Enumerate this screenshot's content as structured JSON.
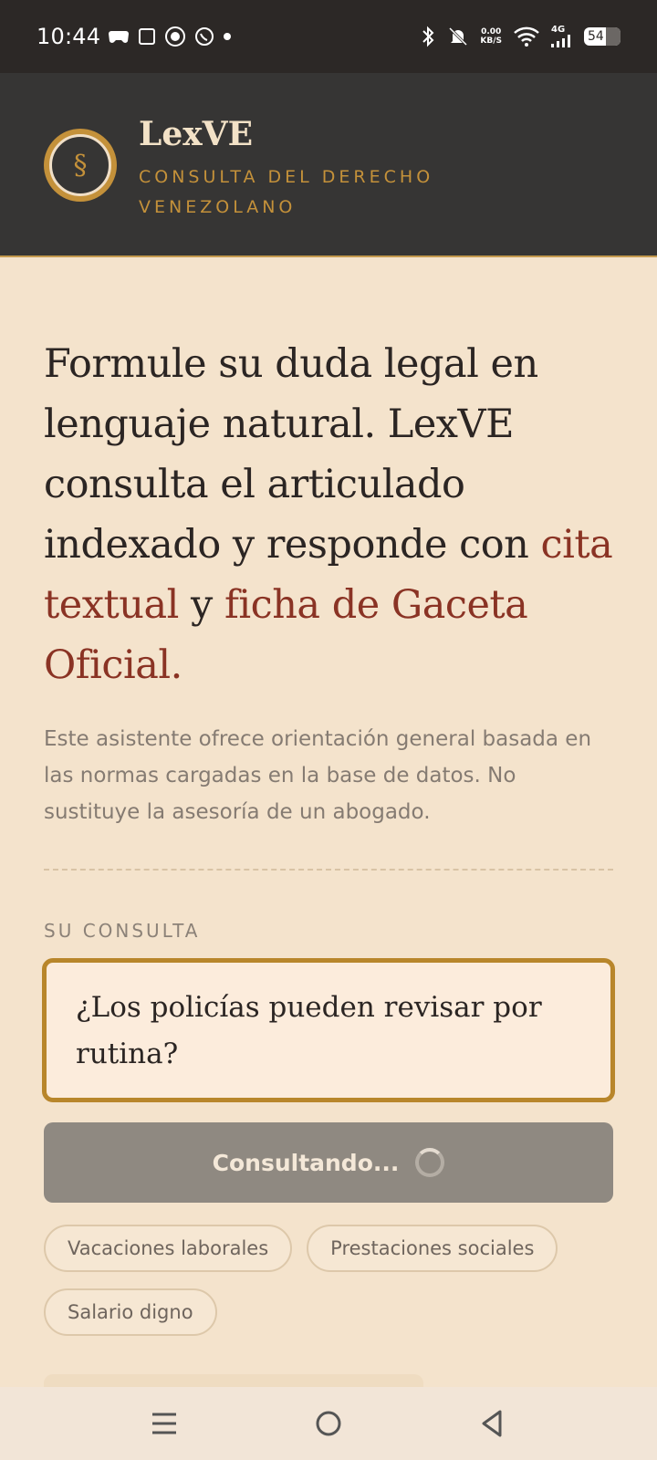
{
  "status_bar": {
    "time": "10:44",
    "net_speed_value": "0.00",
    "net_speed_unit": "KB/S",
    "signal_label": "4G",
    "battery": "54"
  },
  "header": {
    "logo_symbol": "§",
    "title": "LexVE",
    "subtitle": "CONSULTA DEL DERECHO VENEZOLANO"
  },
  "intro": {
    "part1": "Formule su duda legal en lenguaje natural. LexVE consulta el articulado indexado y responde con ",
    "accent1": "cita textual",
    "part2": " y ",
    "accent2": "ficha de Gaceta Oficial",
    "part3": "."
  },
  "disclaimer": "Este asistente ofrece orientación general basada en las normas cargadas en la base de datos. No sustituye la asesoría de un abogado.",
  "query": {
    "label": "SU CONSULTA",
    "value": "¿Los policías pueden revisar por rutina?",
    "submit_label": "Consultando..."
  },
  "suggestions": [
    "Vacaciones laborales",
    "Prestaciones sociales",
    "Salario digno"
  ],
  "colors": {
    "accent": "#8a3324",
    "gold": "#c4913a",
    "header_bg": "#363534",
    "page_bg": "#f4e3cc"
  }
}
